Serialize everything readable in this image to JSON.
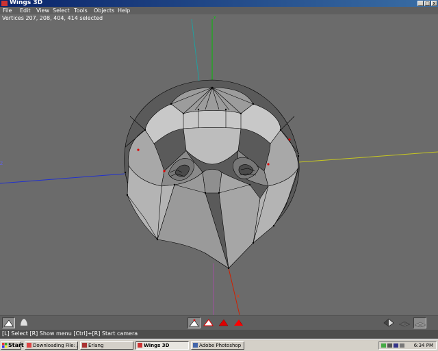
{
  "window": {
    "title": "Wings 3D"
  },
  "menu": [
    "File",
    "Edit",
    "View",
    "Select",
    "Tools",
    "Objects",
    "Help"
  ],
  "status_top": "Vertices 207, 208, 404, 414 selected",
  "axes": {
    "y": "Y",
    "z": "Z",
    "x": "X"
  },
  "axis_colors": {
    "x": "#c00000",
    "y": "#00b000",
    "z": "#0000c0"
  },
  "toolbar": {
    "left": [
      "geometry-view-icon",
      "sphere-icon"
    ],
    "center": [
      "vertex-mode-icon",
      "edge-mode-icon",
      "face-mode-icon",
      "body-mode-icon"
    ],
    "right": [
      "wireframe-icon",
      "smooth-preview-icon",
      "groundplane-icon"
    ]
  },
  "helpbar": "[L] Select  [R] Show menu  [Ctrl]+[R] Start camera",
  "taskbar": {
    "start": "Start",
    "tasks": [
      "Downloading File: /wings/...",
      "Erlang",
      "Wings 3D",
      "Adobe Photoshop"
    ],
    "clock": "6:34 PM"
  }
}
